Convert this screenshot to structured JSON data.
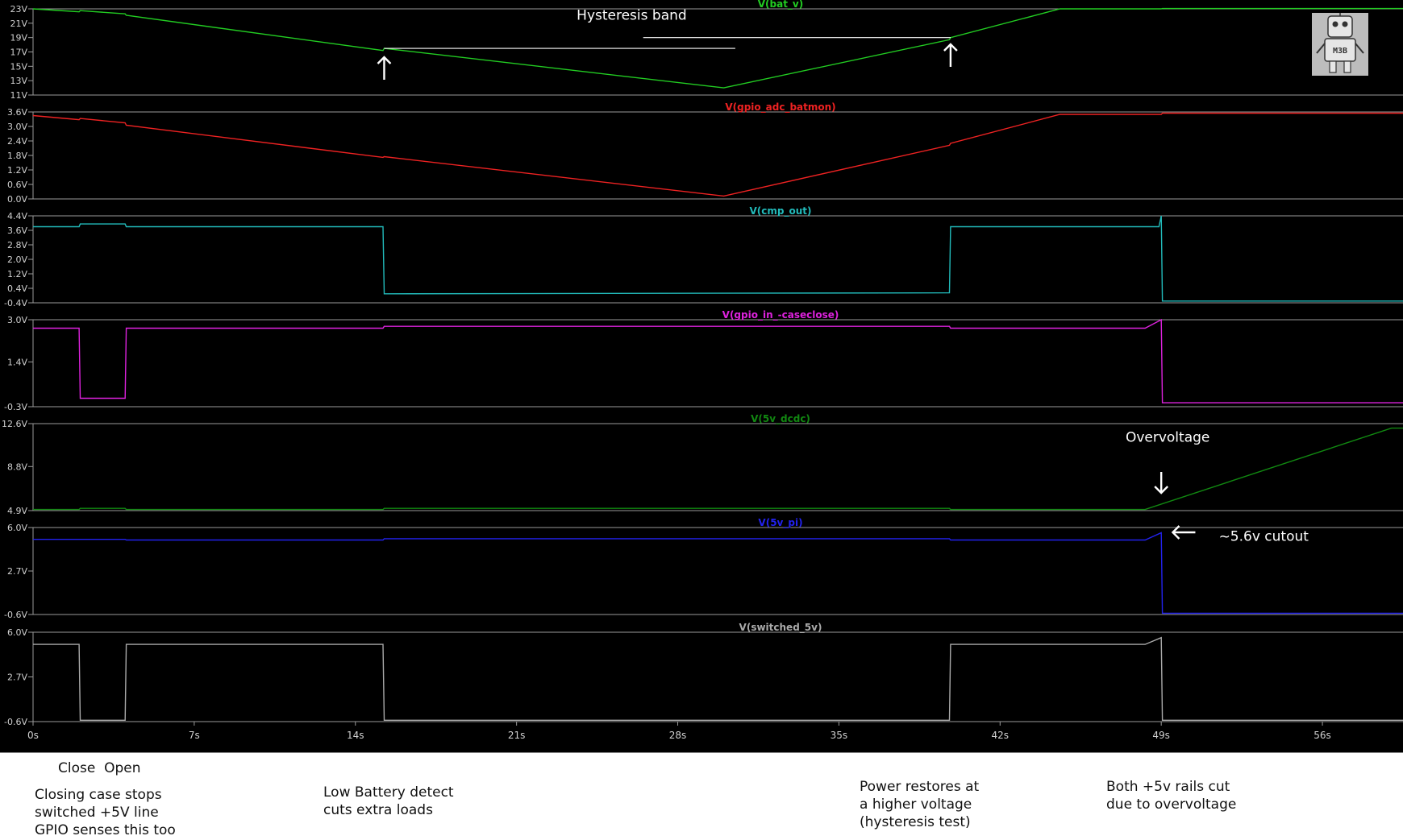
{
  "chart_data": {
    "type": "line",
    "xlabel": "",
    "x_ticks": [
      "0s",
      "7s",
      "14s",
      "21s",
      "28s",
      "35s",
      "42s",
      "49s",
      "56s"
    ],
    "x_tick_values": [
      0,
      7,
      14,
      21,
      28,
      35,
      42,
      49,
      56
    ],
    "xlim": [
      0,
      59.5
    ],
    "panels": [
      {
        "name": "V(bat_v)",
        "color": "#22cc22",
        "ylim": [
          11,
          23
        ],
        "y_ticks": [
          "23V",
          "21V",
          "19V",
          "17V",
          "15V",
          "13V",
          "11V"
        ],
        "y_tick_values": [
          23,
          21,
          19,
          17,
          15,
          13,
          11
        ],
        "points": [
          [
            0,
            23
          ],
          [
            2,
            22.6
          ],
          [
            2.05,
            22.75
          ],
          [
            4,
            22.3
          ],
          [
            4.05,
            22.1
          ],
          [
            15.2,
            17.2
          ],
          [
            15.25,
            17.5
          ],
          [
            30,
            12
          ],
          [
            39.8,
            18.7
          ],
          [
            39.85,
            19
          ],
          [
            44.6,
            23
          ],
          [
            49,
            23
          ],
          [
            49.05,
            23.05
          ],
          [
            59.5,
            23.05
          ]
        ]
      },
      {
        "name": "V(gpio_adc_batmon)",
        "color": "#ee2222",
        "ylim": [
          0,
          3.6
        ],
        "y_ticks": [
          "3.6V",
          "3.0V",
          "2.4V",
          "1.8V",
          "1.2V",
          "0.6V",
          "0.0V"
        ],
        "y_tick_values": [
          3.6,
          3.0,
          2.4,
          1.8,
          1.2,
          0.6,
          0.0
        ],
        "points": [
          [
            0,
            3.45
          ],
          [
            2,
            3.28
          ],
          [
            2.05,
            3.33
          ],
          [
            4,
            3.15
          ],
          [
            4.05,
            3.05
          ],
          [
            15.2,
            1.72
          ],
          [
            15.25,
            1.75
          ],
          [
            30,
            0.12
          ],
          [
            39.8,
            2.22
          ],
          [
            39.85,
            2.3
          ],
          [
            44.6,
            3.5
          ],
          [
            49,
            3.5
          ],
          [
            49.05,
            3.55
          ],
          [
            59.5,
            3.55
          ]
        ]
      },
      {
        "name": "V(cmp_out)",
        "color": "#22bbbb",
        "ylim": [
          -0.4,
          4.4
        ],
        "y_ticks": [
          "4.4V",
          "3.6V",
          "2.8V",
          "2.0V",
          "1.2V",
          "0.4V",
          "-0.4V"
        ],
        "y_tick_values": [
          4.4,
          3.6,
          2.8,
          2.0,
          1.2,
          0.4,
          -0.4
        ],
        "points": [
          [
            0,
            3.8
          ],
          [
            2,
            3.8
          ],
          [
            2.05,
            3.95
          ],
          [
            4,
            3.95
          ],
          [
            4.05,
            3.8
          ],
          [
            15.2,
            3.8
          ],
          [
            15.25,
            0.1
          ],
          [
            39.8,
            0.15
          ],
          [
            39.85,
            3.8
          ],
          [
            48.9,
            3.8
          ],
          [
            49,
            4.4
          ],
          [
            49.05,
            -0.3
          ],
          [
            59.5,
            -0.3
          ]
        ]
      },
      {
        "name": "V(gpio_in_-caseclose)",
        "color": "#dd22dd",
        "ylim": [
          -0.3,
          3.0
        ],
        "y_ticks": [
          "3.0V",
          "1.4V",
          "-0.3V"
        ],
        "y_tick_values": [
          3.0,
          1.4,
          -0.3
        ],
        "points": [
          [
            0,
            2.68
          ],
          [
            2,
            2.68
          ],
          [
            2.05,
            0.02
          ],
          [
            4,
            0.02
          ],
          [
            4.05,
            2.68
          ],
          [
            15.2,
            2.68
          ],
          [
            15.25,
            2.75
          ],
          [
            39.8,
            2.75
          ],
          [
            39.85,
            2.68
          ],
          [
            48.3,
            2.68
          ],
          [
            49,
            3.0
          ],
          [
            49.05,
            -0.15
          ],
          [
            59.5,
            -0.15
          ]
        ]
      },
      {
        "name": "V(5v_dcdc)",
        "color": "#118811",
        "ylim": [
          4.9,
          12.6
        ],
        "y_ticks": [
          "12.6V",
          "8.8V",
          "4.9V"
        ],
        "y_tick_values": [
          12.6,
          8.8,
          4.9
        ],
        "points": [
          [
            0,
            5.0
          ],
          [
            2,
            5.0
          ],
          [
            2.05,
            5.1
          ],
          [
            4,
            5.1
          ],
          [
            4.05,
            5.0
          ],
          [
            15.2,
            5.0
          ],
          [
            15.25,
            5.1
          ],
          [
            39.8,
            5.1
          ],
          [
            39.85,
            5.0
          ],
          [
            48.3,
            5.0
          ],
          [
            59,
            12.2
          ],
          [
            59.5,
            12.2
          ]
        ]
      },
      {
        "name": "V(5v_pi)",
        "color": "#2222ee",
        "ylim": [
          -0.6,
          6.0
        ],
        "y_ticks": [
          "6.0V",
          "2.7V",
          "-0.6V"
        ],
        "y_tick_values": [
          6.0,
          2.7,
          -0.6
        ],
        "points": [
          [
            0,
            5.1
          ],
          [
            4,
            5.1
          ],
          [
            4.05,
            5.05
          ],
          [
            15.2,
            5.05
          ],
          [
            15.25,
            5.15
          ],
          [
            39.8,
            5.15
          ],
          [
            39.85,
            5.05
          ],
          [
            48.3,
            5.05
          ],
          [
            49,
            5.6
          ],
          [
            49.05,
            -0.5
          ],
          [
            59.5,
            -0.5
          ]
        ]
      },
      {
        "name": "V(switched_5v)",
        "color": "#aaaaaa",
        "ylim": [
          -0.6,
          6.0
        ],
        "y_ticks": [
          "6.0V",
          "2.7V",
          "-0.6V"
        ],
        "y_tick_values": [
          6.0,
          2.7,
          -0.6
        ],
        "points": [
          [
            0,
            5.1
          ],
          [
            2,
            5.1
          ],
          [
            2.05,
            -0.5
          ],
          [
            4,
            -0.5
          ],
          [
            4.05,
            5.1
          ],
          [
            15.2,
            5.1
          ],
          [
            15.25,
            -0.5
          ],
          [
            39.8,
            -0.5
          ],
          [
            39.85,
            5.1
          ],
          [
            48.3,
            5.1
          ],
          [
            49,
            5.6
          ],
          [
            49.05,
            -0.5
          ],
          [
            59.5,
            -0.5
          ]
        ]
      }
    ],
    "annotations": [
      {
        "text": "Hysteresis band",
        "x": 26,
        "y": 21.5
      },
      {
        "text": "Overvoltage",
        "x": 49,
        "y": 11
      },
      {
        "text": "~5.6v cutout",
        "x": 51.5,
        "y": 5.0
      }
    ]
  },
  "notes": {
    "caseclose": {
      "line1": "Close  Open",
      "line2": "Closing case stops",
      "line3": "switched +5V line",
      "line4": "GPIO senses this too"
    },
    "lowbat": {
      "line1": "Low Battery detect",
      "line2": "cuts extra loads"
    },
    "restore": {
      "line1": "Power restores at",
      "line2": "a higher voltage",
      "line3": "(hysteresis test)"
    },
    "cut": {
      "line1": "Both +5v rails cut",
      "line2": "due to overvoltage"
    }
  },
  "logo": {
    "text": "M3B"
  }
}
